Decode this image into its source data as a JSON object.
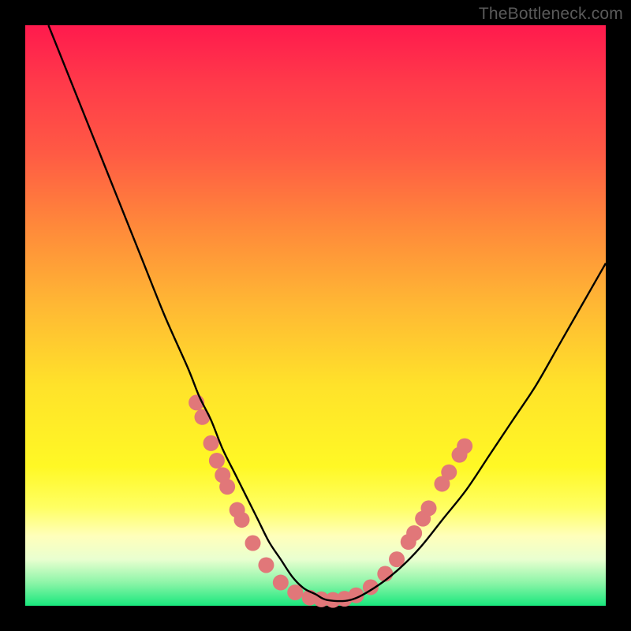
{
  "watermark": "TheBottleneck.com",
  "chart_data": {
    "type": "line",
    "title": "",
    "xlabel": "",
    "ylabel": "",
    "xlim": [
      0,
      100
    ],
    "ylim": [
      0,
      100
    ],
    "grid": false,
    "series": [
      {
        "name": "curve",
        "color": "#000000",
        "x": [
          4,
          8,
          12,
          16,
          20,
          24,
          28,
          30,
          32,
          34,
          36,
          38,
          40,
          42,
          44,
          46,
          48,
          50,
          52,
          56,
          60,
          64,
          68,
          72,
          76,
          80,
          84,
          88,
          92,
          96,
          100
        ],
        "y": [
          100,
          90,
          80,
          70,
          60,
          50,
          41,
          36,
          32,
          27,
          23,
          19,
          15,
          11,
          8,
          5,
          3,
          2,
          1,
          1,
          3,
          6,
          10,
          15,
          20,
          26,
          32,
          38,
          45,
          52,
          59
        ]
      }
    ],
    "markers": [
      {
        "x": 29.5,
        "y": 35.0
      },
      {
        "x": 30.5,
        "y": 32.5
      },
      {
        "x": 32.0,
        "y": 28.0
      },
      {
        "x": 33.0,
        "y": 25.0
      },
      {
        "x": 34.0,
        "y": 22.5
      },
      {
        "x": 34.8,
        "y": 20.5
      },
      {
        "x": 36.5,
        "y": 16.5
      },
      {
        "x": 37.3,
        "y": 14.8
      },
      {
        "x": 39.2,
        "y": 10.8
      },
      {
        "x": 41.5,
        "y": 7.0
      },
      {
        "x": 44.0,
        "y": 4.0
      },
      {
        "x": 46.5,
        "y": 2.3
      },
      {
        "x": 49.0,
        "y": 1.4
      },
      {
        "x": 51.0,
        "y": 1.1
      },
      {
        "x": 53.0,
        "y": 1.0
      },
      {
        "x": 55.0,
        "y": 1.2
      },
      {
        "x": 57.0,
        "y": 1.8
      },
      {
        "x": 59.5,
        "y": 3.2
      },
      {
        "x": 62.0,
        "y": 5.5
      },
      {
        "x": 64.0,
        "y": 8.0
      },
      {
        "x": 66.0,
        "y": 11.0
      },
      {
        "x": 67.0,
        "y": 12.5
      },
      {
        "x": 68.5,
        "y": 15.0
      },
      {
        "x": 69.5,
        "y": 16.8
      },
      {
        "x": 71.8,
        "y": 21.0
      },
      {
        "x": 73.0,
        "y": 23.0
      },
      {
        "x": 74.8,
        "y": 26.0
      },
      {
        "x": 75.7,
        "y": 27.5
      }
    ],
    "marker_style": {
      "color": "#e17779",
      "radius_px": 10
    }
  }
}
